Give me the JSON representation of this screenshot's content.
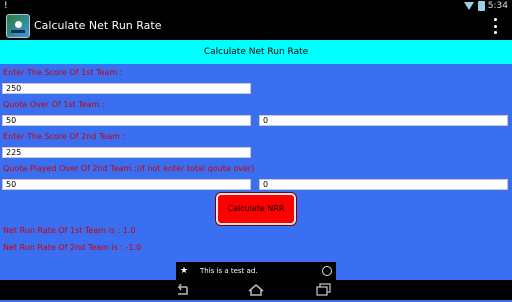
{
  "status_bar": {
    "time": "5:34",
    "alert_glyph": "!",
    "icons": [
      "warning-icon",
      "wifi-icon",
      "battery-icon"
    ]
  },
  "app_bar": {
    "title": "Calculate Net Run Rate",
    "icon": "cricket-app-icon",
    "menu_icon": "overflow-menu-icon"
  },
  "header": {
    "title": "Calculate Net Run Rate"
  },
  "form": {
    "team1_score_label": "Enter The Score Of 1st Team :",
    "team1_score_value": "250",
    "team1_quota_label": "Quota Over Of 1st Team :",
    "team1_overs_value": "50",
    "team1_balls_value": "0",
    "team2_score_label": "Enter The Score Of 2nd Team :",
    "team2_score_value": "225",
    "team2_played_label": "Quota Played Over Of 2nd Team :(if not enter total qouta over)",
    "team2_overs_value": "50",
    "team2_balls_value": "0"
  },
  "button": {
    "calculate_label": "Calculate NRR"
  },
  "results": {
    "team1_nrr": "Net Run Rate Of 1st Team is : 1.0",
    "team2_nrr": "Net Run Rate Of 2nd Team is : -1.0"
  },
  "ad": {
    "text": "This is a test ad.",
    "icon": "ad-app-icon",
    "globe_icon": "globe-icon"
  },
  "colors": {
    "background": "#3b6ff2",
    "header_bar": "#00ffff",
    "label_text": "#cc0000",
    "button": "#ff0000"
  }
}
